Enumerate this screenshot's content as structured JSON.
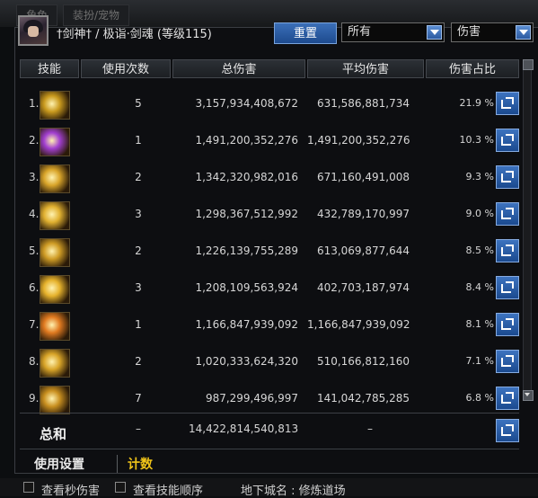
{
  "window": {
    "bg_tabs": [
      "角色",
      "装扮/宠物"
    ]
  },
  "character": {
    "title": "†剑神† / 极诣·剑魂 (等级115)"
  },
  "controls": {
    "reset_label": "重置",
    "filter_value": "所有",
    "sort_value": "伤害"
  },
  "table": {
    "headers": [
      "技能",
      "使用次数",
      "总伤害",
      "平均伤害",
      "伤害占比"
    ],
    "rows": [
      {
        "rank": "1.",
        "count": "5",
        "total": "3,157,934,408,672",
        "avg": "631,586,881,734",
        "pct": "21.9 %",
        "icon": "golden-spiral-slash-icon",
        "color": "#c99a1e"
      },
      {
        "rank": "2.",
        "count": "1",
        "total": "1,491,200,352,276",
        "avg": "1,491,200,352,276",
        "pct": "10.3 %",
        "icon": "purple-blade-burst-icon",
        "color": "#a23fd0"
      },
      {
        "rank": "3.",
        "count": "2",
        "total": "1,342,320,982,016",
        "avg": "671,160,491,008",
        "pct": "9.3 %",
        "icon": "golden-sword-strike-icon",
        "color": "#d9a52a"
      },
      {
        "rank": "4.",
        "count": "3",
        "total": "1,298,367,512,992",
        "avg": "432,789,170,997",
        "pct": "9.0 %",
        "icon": "golden-crescent-icon",
        "color": "#e0b030"
      },
      {
        "rank": "5.",
        "count": "2",
        "total": "1,226,139,755,289",
        "avg": "613,069,877,644",
        "pct": "8.5 %",
        "icon": "golden-wave-slash-icon",
        "color": "#cf9c25"
      },
      {
        "rank": "6.",
        "count": "3",
        "total": "1,208,109,563,924",
        "avg": "402,703,187,974",
        "pct": "8.4 %",
        "icon": "golden-multi-slash-icon",
        "color": "#e6b22c"
      },
      {
        "rank": "7.",
        "count": "1",
        "total": "1,166,847,939,092",
        "avg": "1,166,847,939,092",
        "pct": "8.1 %",
        "icon": "orange-explosion-icon",
        "color": "#e07a20"
      },
      {
        "rank": "8.",
        "count": "2",
        "total": "1,020,333,624,320",
        "avg": "510,166,812,160",
        "pct": "7.1 %",
        "icon": "golden-starburst-icon",
        "color": "#d8a428"
      },
      {
        "rank": "9.",
        "count": "7",
        "total": "987,299,496,997",
        "avg": "141,042,785,285",
        "pct": "6.8 %",
        "icon": "golden-arc-slash-icon",
        "color": "#c99020"
      }
    ],
    "summary": {
      "label": "总和",
      "count": "–",
      "total": "14,422,814,540,813",
      "avg": "–"
    }
  },
  "tabs": {
    "settings": "使用设置",
    "count": "计数"
  },
  "footer": {
    "check_per_second": "查看秒伤害",
    "check_order": "查看技能顺序",
    "location": "地下城名 : 修炼道场"
  },
  "colors": {
    "accent": "#2a5ea8",
    "highlight": "#f0c419"
  }
}
